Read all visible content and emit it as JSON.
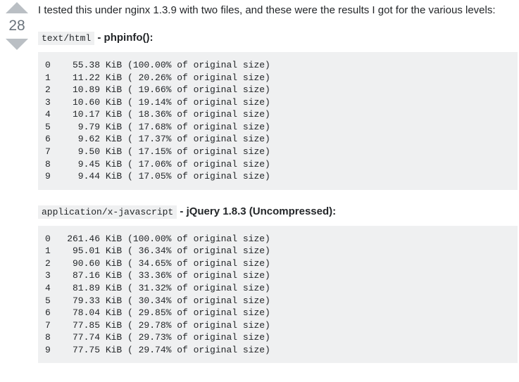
{
  "vote": {
    "count": 28
  },
  "intro": "I tested this under nginx 1.3.9 with two files, and these were the results I got for the various levels:",
  "sections": [
    {
      "mime": "text/html",
      "label": " - phpinfo():",
      "rows": [
        {
          "lvl": "0",
          "size": " 55.38 KiB",
          "pct": "100.00%"
        },
        {
          "lvl": "1",
          "size": " 11.22 KiB",
          "pct": " 20.26%"
        },
        {
          "lvl": "2",
          "size": " 10.89 KiB",
          "pct": " 19.66%"
        },
        {
          "lvl": "3",
          "size": " 10.60 KiB",
          "pct": " 19.14%"
        },
        {
          "lvl": "4",
          "size": " 10.17 KiB",
          "pct": " 18.36%"
        },
        {
          "lvl": "5",
          "size": "  9.79 KiB",
          "pct": " 17.68%"
        },
        {
          "lvl": "6",
          "size": "  9.62 KiB",
          "pct": " 17.37%"
        },
        {
          "lvl": "7",
          "size": "  9.50 KiB",
          "pct": " 17.15%"
        },
        {
          "lvl": "8",
          "size": "  9.45 KiB",
          "pct": " 17.06%"
        },
        {
          "lvl": "9",
          "size": "  9.44 KiB",
          "pct": " 17.05%"
        }
      ]
    },
    {
      "mime": "application/x-javascript",
      "label": " - jQuery 1.8.3 (Uncompressed):",
      "rows": [
        {
          "lvl": "0",
          "size": "261.46 KiB",
          "pct": "100.00%"
        },
        {
          "lvl": "1",
          "size": " 95.01 KiB",
          "pct": " 36.34%"
        },
        {
          "lvl": "2",
          "size": " 90.60 KiB",
          "pct": " 34.65%"
        },
        {
          "lvl": "3",
          "size": " 87.16 KiB",
          "pct": " 33.36%"
        },
        {
          "lvl": "4",
          "size": " 81.89 KiB",
          "pct": " 31.32%"
        },
        {
          "lvl": "5",
          "size": " 79.33 KiB",
          "pct": " 30.34%"
        },
        {
          "lvl": "6",
          "size": " 78.04 KiB",
          "pct": " 29.85%"
        },
        {
          "lvl": "7",
          "size": " 77.85 KiB",
          "pct": " 29.78%"
        },
        {
          "lvl": "8",
          "size": " 77.74 KiB",
          "pct": " 29.73%"
        },
        {
          "lvl": "9",
          "size": " 77.75 KiB",
          "pct": " 29.74%"
        }
      ]
    }
  ],
  "chart_data": [
    {
      "type": "table",
      "title": "text/html - phpinfo()",
      "columns": [
        "level",
        "size_kib",
        "percent_of_original"
      ],
      "rows": [
        [
          0,
          55.38,
          100.0
        ],
        [
          1,
          11.22,
          20.26
        ],
        [
          2,
          10.89,
          19.66
        ],
        [
          3,
          10.6,
          19.14
        ],
        [
          4,
          10.17,
          18.36
        ],
        [
          5,
          9.79,
          17.68
        ],
        [
          6,
          9.62,
          17.37
        ],
        [
          7,
          9.5,
          17.15
        ],
        [
          8,
          9.45,
          17.06
        ],
        [
          9,
          9.44,
          17.05
        ]
      ]
    },
    {
      "type": "table",
      "title": "application/x-javascript - jQuery 1.8.3 (Uncompressed)",
      "columns": [
        "level",
        "size_kib",
        "percent_of_original"
      ],
      "rows": [
        [
          0,
          261.46,
          100.0
        ],
        [
          1,
          95.01,
          36.34
        ],
        [
          2,
          90.6,
          34.65
        ],
        [
          3,
          87.16,
          33.36
        ],
        [
          4,
          81.89,
          31.32
        ],
        [
          5,
          79.33,
          30.34
        ],
        [
          6,
          78.04,
          29.85
        ],
        [
          7,
          77.85,
          29.78
        ],
        [
          8,
          77.74,
          29.73
        ],
        [
          9,
          77.75,
          29.74
        ]
      ]
    }
  ]
}
